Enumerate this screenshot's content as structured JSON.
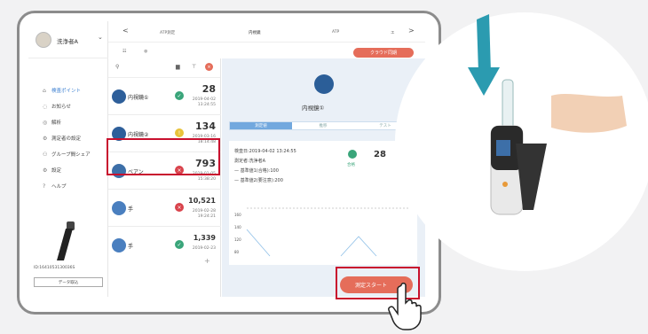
{
  "user": {
    "name": "洗浄者A"
  },
  "sidebar": {
    "items": [
      {
        "label": "検査ポイント",
        "icon": "home-icon"
      },
      {
        "label": "お知らせ",
        "icon": "bell-icon"
      },
      {
        "label": "解析",
        "icon": "analysis-icon"
      },
      {
        "label": "測定者の設定",
        "icon": "person-settings-icon"
      },
      {
        "label": "グループ間シェア",
        "icon": "group-share-icon"
      },
      {
        "label": "設定",
        "icon": "gear-icon"
      },
      {
        "label": "ヘルプ",
        "icon": "help-icon"
      }
    ],
    "device_id": "ID:1641053130036S",
    "data_button": "データ取込"
  },
  "topnav": {
    "left": "<",
    "right": ">",
    "tabs": [
      "ATP測定",
      "内視鏡",
      "ATP",
      "エ"
    ]
  },
  "toolbar": {
    "cloud_button": "クラウド同期"
  },
  "list": [
    {
      "name": "内視鏡①",
      "status": "ok",
      "value": "28",
      "date": "2019-04-02",
      "time": "13:24:55"
    },
    {
      "name": "内視鏡②",
      "status": "warn",
      "value": "134",
      "date": "2019-03-16",
      "time": "18:14:48"
    },
    {
      "name": "ベアン",
      "status": "ng",
      "value": "793",
      "date": "2019-01-05",
      "time": "15:38:20"
    },
    {
      "name": "手",
      "status": "ng",
      "value": "10,521",
      "date": "2019-02-28",
      "time": "19:24:21"
    },
    {
      "name": "手",
      "status": "ok",
      "value": "1,339",
      "date": "2019-02-23",
      "time": ""
    }
  ],
  "detail": {
    "title": "内視鏡①",
    "tabs": [
      "測定値",
      "推移",
      "テスト"
    ],
    "line1": "検査日:2019-04-02 13:24:55",
    "line2": "測定者:洗浄者A",
    "line3": "— 基準値1(合格):100",
    "line4": "— 基準値2(要注意):200",
    "status_text": "合格",
    "value": "28",
    "chart_ticks": [
      "160",
      "140",
      "120",
      "80"
    ]
  },
  "start_button": "測定スタート",
  "colors": {
    "accent": "#e56d5a",
    "highlight": "#c8102e",
    "ok": "#3aa57a",
    "warn": "#e8c33b",
    "ng": "#d9434c",
    "brand": "#2b5e98"
  }
}
